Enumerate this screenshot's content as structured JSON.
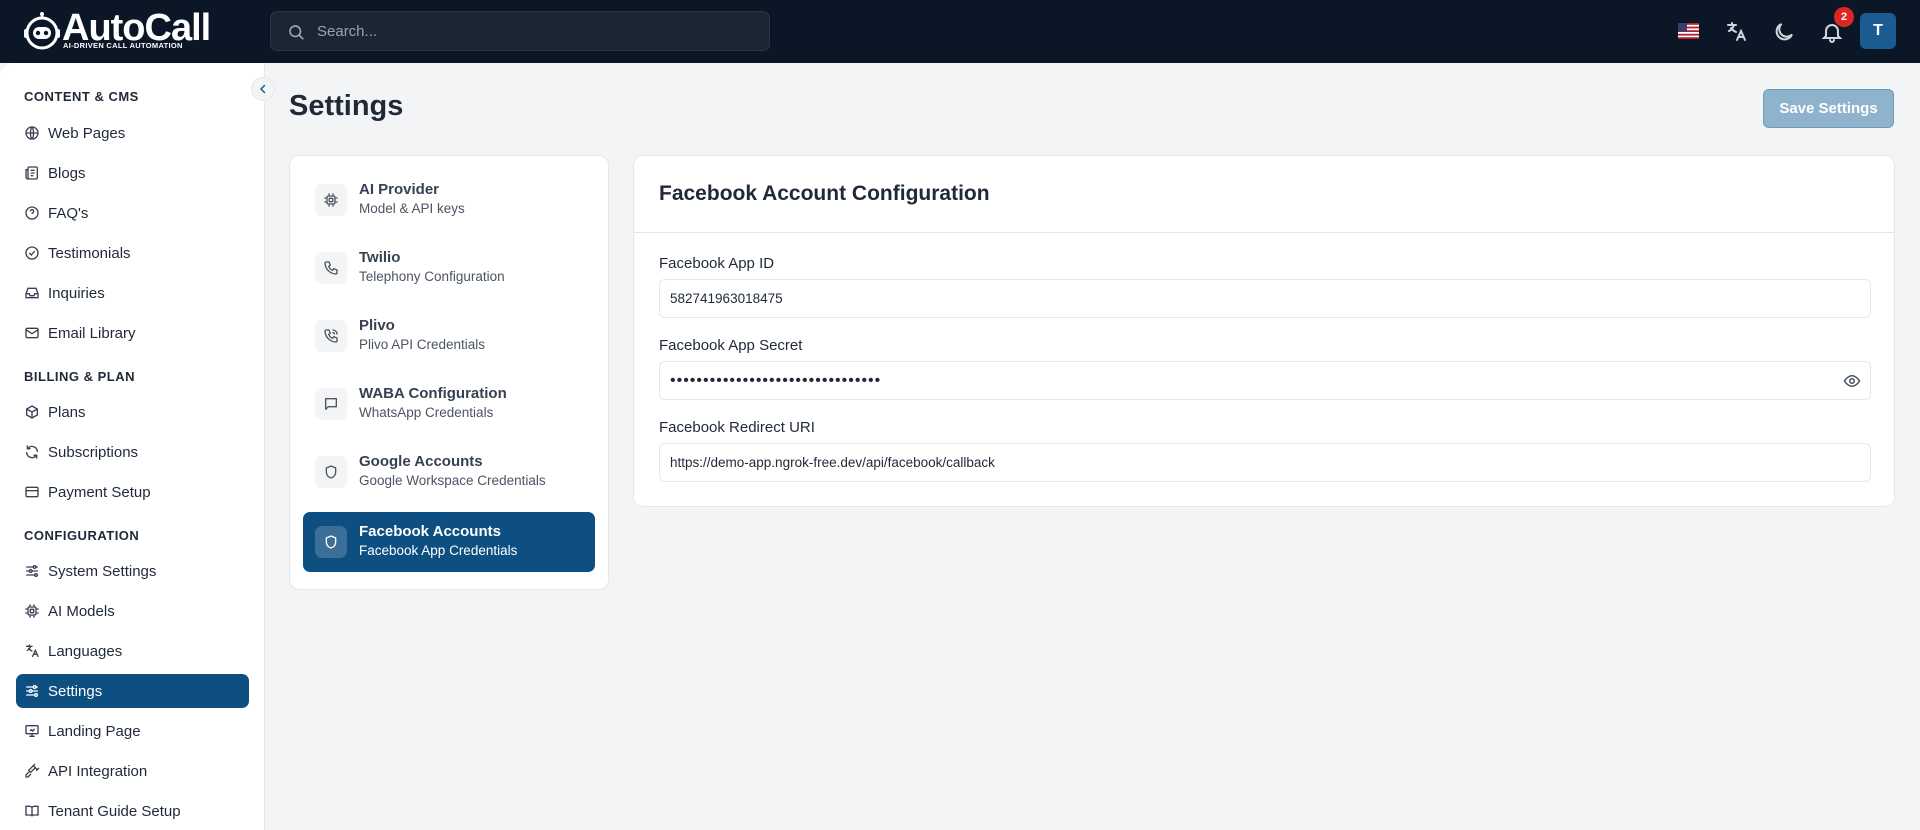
{
  "brand": {
    "name": "AutoCall",
    "tagline": "AI-DRIVEN CALL AUTOMATION"
  },
  "search": {
    "placeholder": "Search..."
  },
  "topbar": {
    "notification_count": "2",
    "avatar_initial": "T",
    "language_flag": "us-flag-icon"
  },
  "sidebar": {
    "sections": [
      {
        "title": "CONTENT & CMS",
        "items": [
          {
            "label": "Web Pages",
            "icon": "globe-icon"
          },
          {
            "label": "Blogs",
            "icon": "newspaper-icon"
          },
          {
            "label": "FAQ's",
            "icon": "help-circle-icon"
          },
          {
            "label": "Testimonials",
            "icon": "check-circle-icon"
          },
          {
            "label": "Inquiries",
            "icon": "inbox-icon"
          },
          {
            "label": "Email Library",
            "icon": "mail-icon"
          }
        ]
      },
      {
        "title": "BILLING & PLAN",
        "items": [
          {
            "label": "Plans",
            "icon": "package-icon"
          },
          {
            "label": "Subscriptions",
            "icon": "refresh-icon"
          },
          {
            "label": "Payment Setup",
            "icon": "credit-card-icon"
          }
        ]
      },
      {
        "title": "CONFIGURATION",
        "items": [
          {
            "label": "System Settings",
            "icon": "sliders-icon"
          },
          {
            "label": "AI Models",
            "icon": "cpu-icon"
          },
          {
            "label": "Languages",
            "icon": "translate-icon"
          },
          {
            "label": "Settings",
            "icon": "settings-sliders-icon",
            "active": true
          },
          {
            "label": "Landing Page",
            "icon": "presentation-icon"
          },
          {
            "label": "API Integration",
            "icon": "plug-icon"
          },
          {
            "label": "Tenant Guide Setup",
            "icon": "book-icon"
          }
        ]
      }
    ]
  },
  "page": {
    "title": "Settings",
    "save_label": "Save Settings"
  },
  "settings_tabs": [
    {
      "title": "AI Provider",
      "subtitle": "Model & API keys",
      "icon": "cpu-icon"
    },
    {
      "title": "Twilio",
      "subtitle": "Telephony Configuration",
      "icon": "phone-icon"
    },
    {
      "title": "Plivo",
      "subtitle": "Plivo API Credentials",
      "icon": "phone-call-icon"
    },
    {
      "title": "WABA Configuration",
      "subtitle": "WhatsApp Credentials",
      "icon": "message-icon"
    },
    {
      "title": "Google Accounts",
      "subtitle": "Google Workspace Credentials",
      "icon": "shield-icon"
    },
    {
      "title": "Facebook Accounts",
      "subtitle": "Facebook App Credentials",
      "icon": "shield-icon",
      "active": true
    }
  ],
  "config": {
    "title": "Facebook Account Configuration",
    "fields": [
      {
        "label": "Facebook App ID",
        "value": "582741963018475"
      },
      {
        "label": "Facebook App Secret",
        "value": "••••••••••••••••••••••••••••••••"
      },
      {
        "label": "Facebook Redirect URI",
        "value": "https://demo-app.ngrok-free.dev/api/facebook/callback"
      }
    ]
  },
  "colors": {
    "topbar": "#0b1727",
    "accent": "#0d4f80",
    "save_button": "#8fb3cc",
    "badge": "#dc2626"
  }
}
